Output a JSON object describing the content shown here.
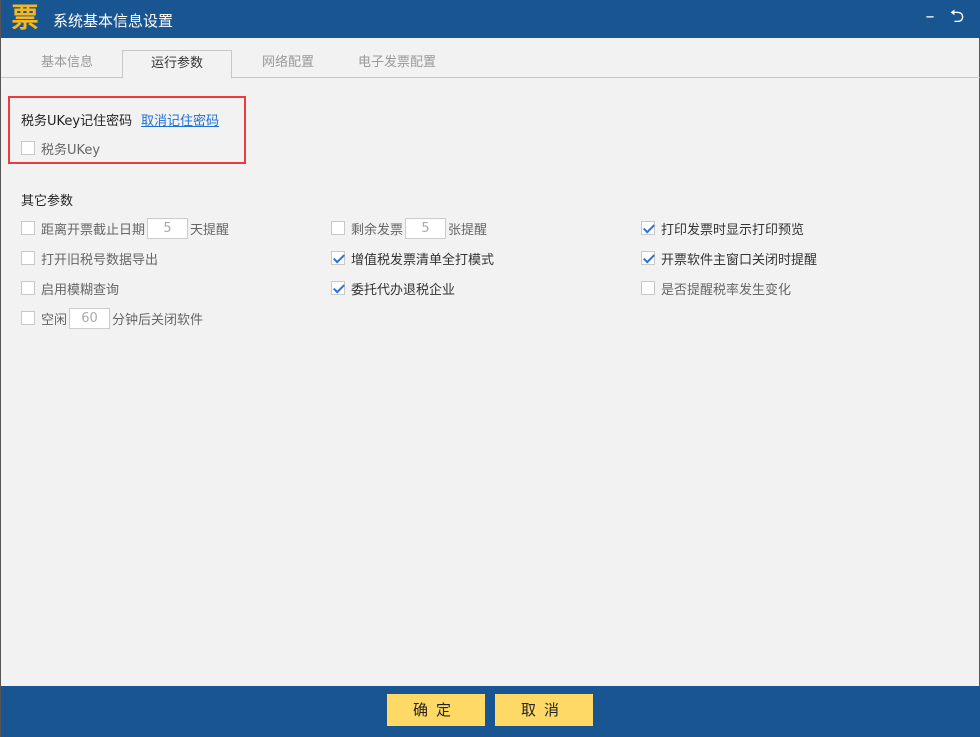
{
  "window": {
    "logo": "票",
    "title": "系统基本信息设置",
    "minimize": "–",
    "back": "⮌"
  },
  "tabs": [
    {
      "label": "基本信息"
    },
    {
      "label": "运行参数"
    },
    {
      "label": "网络配置"
    },
    {
      "label": "电子发票配置"
    }
  ],
  "ukey": {
    "label": "税务UKey记住密码",
    "link": "取消记住密码",
    "checkbox_label": "税务UKey",
    "checked": false
  },
  "other": {
    "heading": "其它参数",
    "deadline": {
      "before": "距离开票截止日期",
      "value": "5",
      "after": "天提醒",
      "checked": false
    },
    "remaining": {
      "before": "剩余发票",
      "value": "5",
      "after": "张提醒",
      "checked": false
    },
    "print_preview": {
      "label": "打印发票时显示打印预览",
      "checked": true
    },
    "export_old": {
      "label": "打开旧税号数据导出",
      "checked": false
    },
    "vat_list": {
      "label": "增值税发票清单全打模式",
      "checked": true
    },
    "close_remind": {
      "label": "开票软件主窗口关闭时提醒",
      "checked": true
    },
    "fuzzy": {
      "label": "启用模糊查询",
      "checked": false
    },
    "refund": {
      "label": "委托代办退税企业",
      "checked": true
    },
    "tax_rate": {
      "label": "是否提醒税率发生变化",
      "checked": false
    },
    "idle": {
      "before": "空闲",
      "value": "60",
      "after": "分钟后关闭软件",
      "checked": false
    }
  },
  "footer": {
    "ok": "确定",
    "cancel": "取消"
  }
}
